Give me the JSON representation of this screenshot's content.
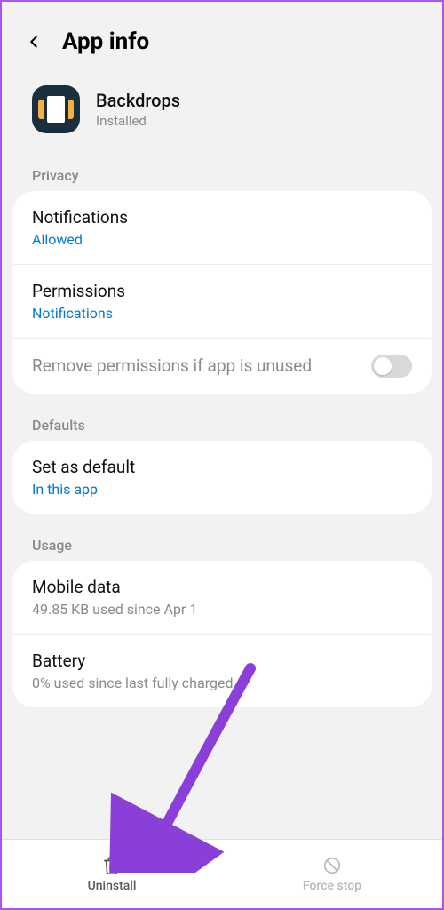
{
  "header": {
    "title": "App info"
  },
  "app": {
    "name": "Backdrops",
    "status": "Installed"
  },
  "sections": {
    "privacy": {
      "label": "Privacy",
      "notifications": {
        "title": "Notifications",
        "value": "Allowed"
      },
      "permissions": {
        "title": "Permissions",
        "value": "Notifications"
      },
      "remove_perms": {
        "title": "Remove permissions if app is unused",
        "enabled": false
      }
    },
    "defaults": {
      "label": "Defaults",
      "set_default": {
        "title": "Set as default",
        "value": "In this app"
      }
    },
    "usage": {
      "label": "Usage",
      "mobile_data": {
        "title": "Mobile data",
        "value": "49.85 KB used since Apr 1"
      },
      "battery": {
        "title": "Battery",
        "value": "0% used since last fully charged"
      }
    }
  },
  "bottom": {
    "uninstall": "Uninstall",
    "force_stop": "Force stop"
  }
}
